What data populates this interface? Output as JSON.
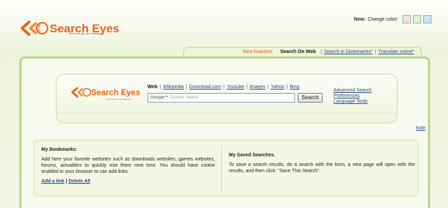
{
  "header": {
    "logo_text": "Search Eyes",
    "logo_tagline": "find what you are looking for",
    "new_label": "New:",
    "change_color_label": "Change color!",
    "swatches": [
      "#f6e1dc",
      "#e4f1c9",
      "#cde3f6"
    ]
  },
  "tabs": {
    "new_features": "New features!",
    "search_on_web": "Search On Web",
    "search_dictionaries": "Search in Dictionaries*",
    "translate_online": "Translate online*",
    "separator": "|"
  },
  "search": {
    "logo_text": "Search Eyes",
    "logo_tagline": "find what you are looking for",
    "engines": {
      "current": "Web",
      "links": [
        "Wikipedia",
        "Download.com",
        "Youtube",
        "Images",
        "Yahoo",
        "Bing"
      ],
      "separator": "|"
    },
    "query_google": "Google™",
    "query_placeholder": "Custom Search",
    "button_label": "Search",
    "advanced_search": "Advanced Search",
    "preferences": "Preferences",
    "language_tools": "Language Tools"
  },
  "hide_label": "hide",
  "bookmarks": {
    "title": "My Bookmarks:",
    "text": "Add here your favorite websites such as downloads websites, games websites, forums, actualities to quickly visit them next time. You should have cookie enabled in your browser to can add links.",
    "add_link": "Add a link",
    "separator": "|",
    "delete_all": "Delete All"
  },
  "saved": {
    "title": "My Saved Searches.",
    "text": "To save a search results, do a search with the form, a new page will open with the results, and then click: “Save This Search”."
  },
  "colors": {
    "brand": "#e8641a",
    "link": "#2a4a8a",
    "frame": "#b9d48a"
  }
}
